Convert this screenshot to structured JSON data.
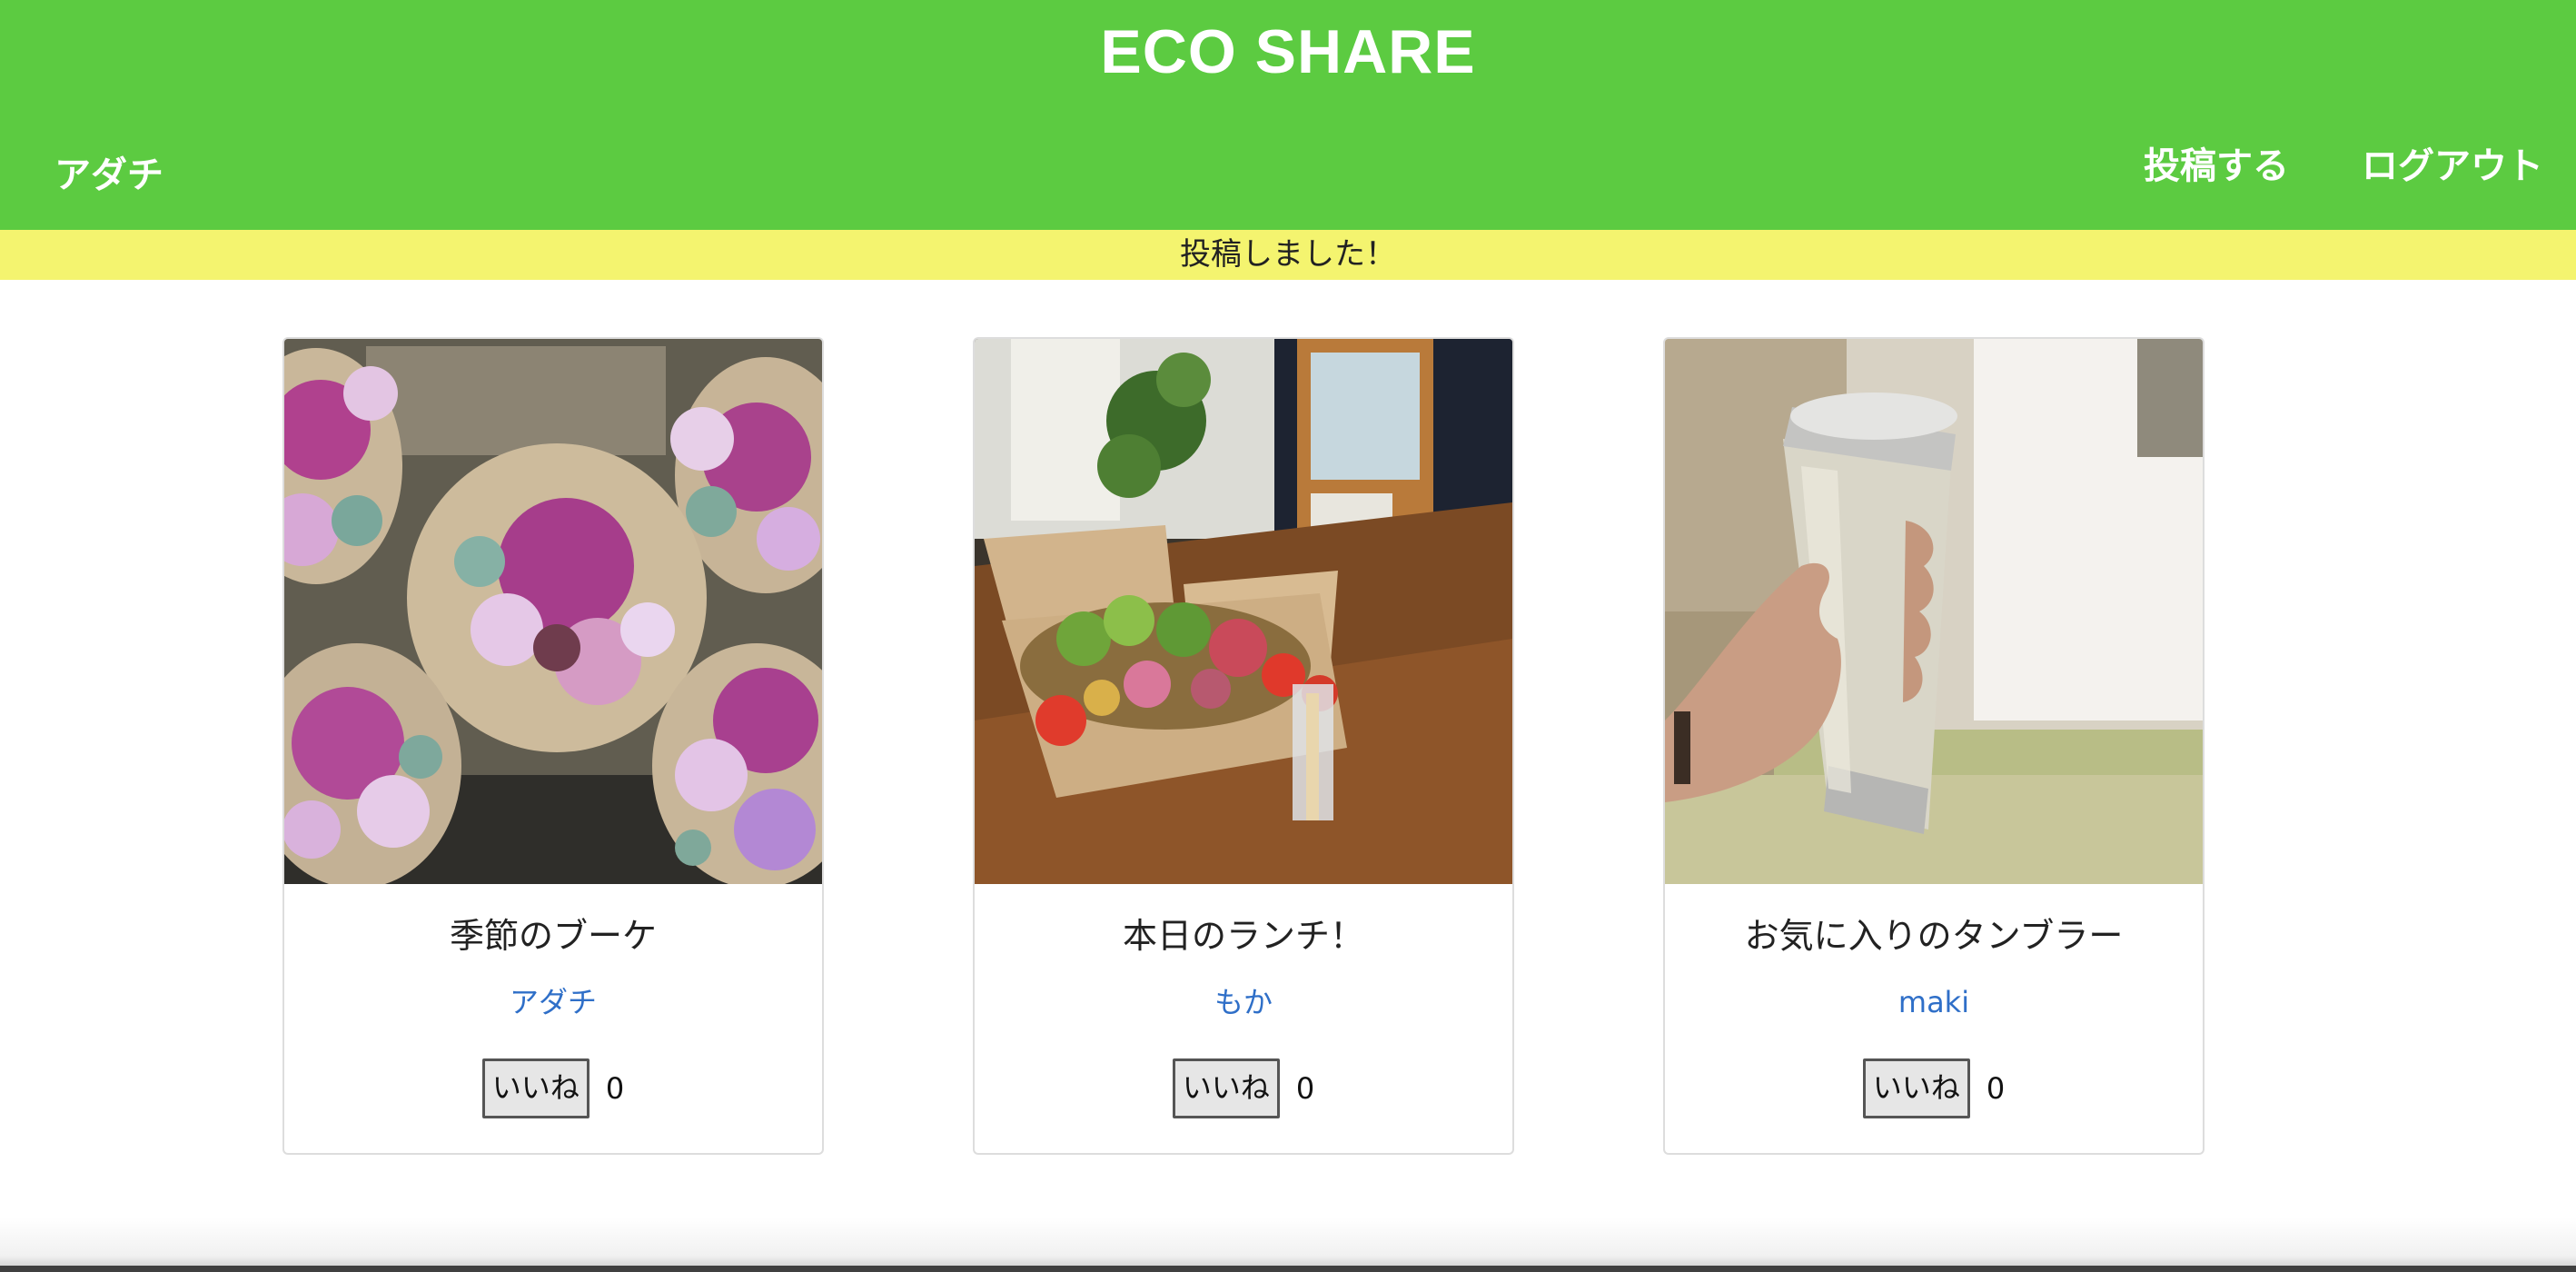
{
  "header": {
    "brand": "ECO SHARE",
    "user_name": "アダチ",
    "nav": {
      "post_label": "投稿する",
      "logout_label": "ログアウト"
    },
    "background_color": "#5ccb41"
  },
  "flash": {
    "message": "投稿しました！",
    "background_color": "#f4f46f"
  },
  "posts": [
    {
      "image": "flower-bouquets-photo",
      "title": "季節のブーケ",
      "author": "アダチ",
      "like_label": "いいね",
      "like_count": "0"
    },
    {
      "image": "salad-lunch-box-photo",
      "title": "本日のランチ！",
      "author": "もか",
      "like_label": "いいね",
      "like_count": "0"
    },
    {
      "image": "white-tumbler-photo",
      "title": "お気に入りのタンブラー",
      "author": "maki",
      "like_label": "いいね",
      "like_count": "0"
    }
  ],
  "colors": {
    "author_link": "#2f6fc8"
  }
}
